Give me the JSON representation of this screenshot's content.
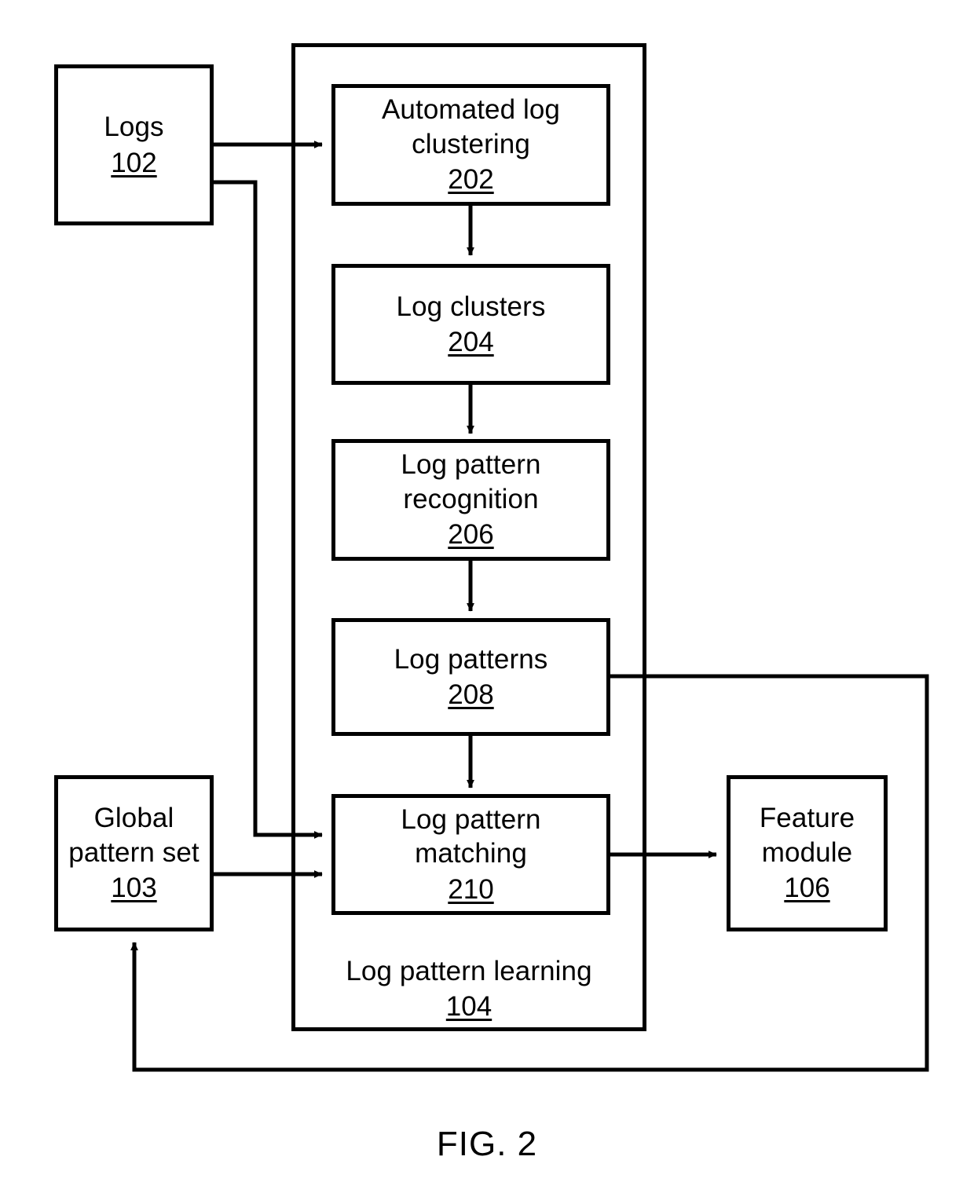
{
  "figure": {
    "caption": "FIG. 2",
    "background_color": "#ffffff",
    "line_color": "#000000"
  },
  "nodes": {
    "logs": {
      "label": "Logs",
      "ref": "102"
    },
    "global_pattern_set": {
      "label": "Global\npattern set",
      "ref": "103"
    },
    "automated_log_clustering": {
      "label": "Automated log\nclustering",
      "ref": "202"
    },
    "log_clusters": {
      "label": "Log clusters",
      "ref": "204"
    },
    "log_pattern_recognition": {
      "label": "Log pattern\nrecognition",
      "ref": "206"
    },
    "log_patterns": {
      "label": "Log patterns",
      "ref": "208"
    },
    "log_pattern_matching": {
      "label": "Log pattern\nmatching",
      "ref": "210"
    },
    "feature_module": {
      "label": "Feature\nmodule",
      "ref": "106"
    },
    "log_pattern_learning": {
      "label": "Log pattern learning",
      "ref": "104"
    }
  },
  "chart_data": {
    "type": "diagram",
    "title": "FIG. 2",
    "nodes": [
      {
        "id": "102",
        "label": "Logs",
        "ref": "102"
      },
      {
        "id": "103",
        "label": "Global pattern set",
        "ref": "103"
      },
      {
        "id": "104",
        "label": "Log pattern learning",
        "ref": "104",
        "is_container": true
      },
      {
        "id": "202",
        "label": "Automated log clustering",
        "ref": "202"
      },
      {
        "id": "204",
        "label": "Log clusters",
        "ref": "204"
      },
      {
        "id": "206",
        "label": "Log pattern recognition",
        "ref": "206"
      },
      {
        "id": "208",
        "label": "Log patterns",
        "ref": "208"
      },
      {
        "id": "210",
        "label": "Log pattern matching",
        "ref": "210"
      },
      {
        "id": "106",
        "label": "Feature module",
        "ref": "106"
      }
    ],
    "edges": [
      {
        "from": "102",
        "to": "202",
        "arrow": true
      },
      {
        "from": "102",
        "to": "210",
        "arrow": true
      },
      {
        "from": "202",
        "to": "204",
        "arrow": true
      },
      {
        "from": "204",
        "to": "206",
        "arrow": true
      },
      {
        "from": "206",
        "to": "208",
        "arrow": true
      },
      {
        "from": "208",
        "to": "210",
        "arrow": true
      },
      {
        "from": "103",
        "to": "210",
        "arrow": true
      },
      {
        "from": "210",
        "to": "106",
        "arrow": true
      },
      {
        "from": "208",
        "to": "103",
        "arrow": true,
        "note": "feedback loop routed around bottom"
      }
    ]
  }
}
